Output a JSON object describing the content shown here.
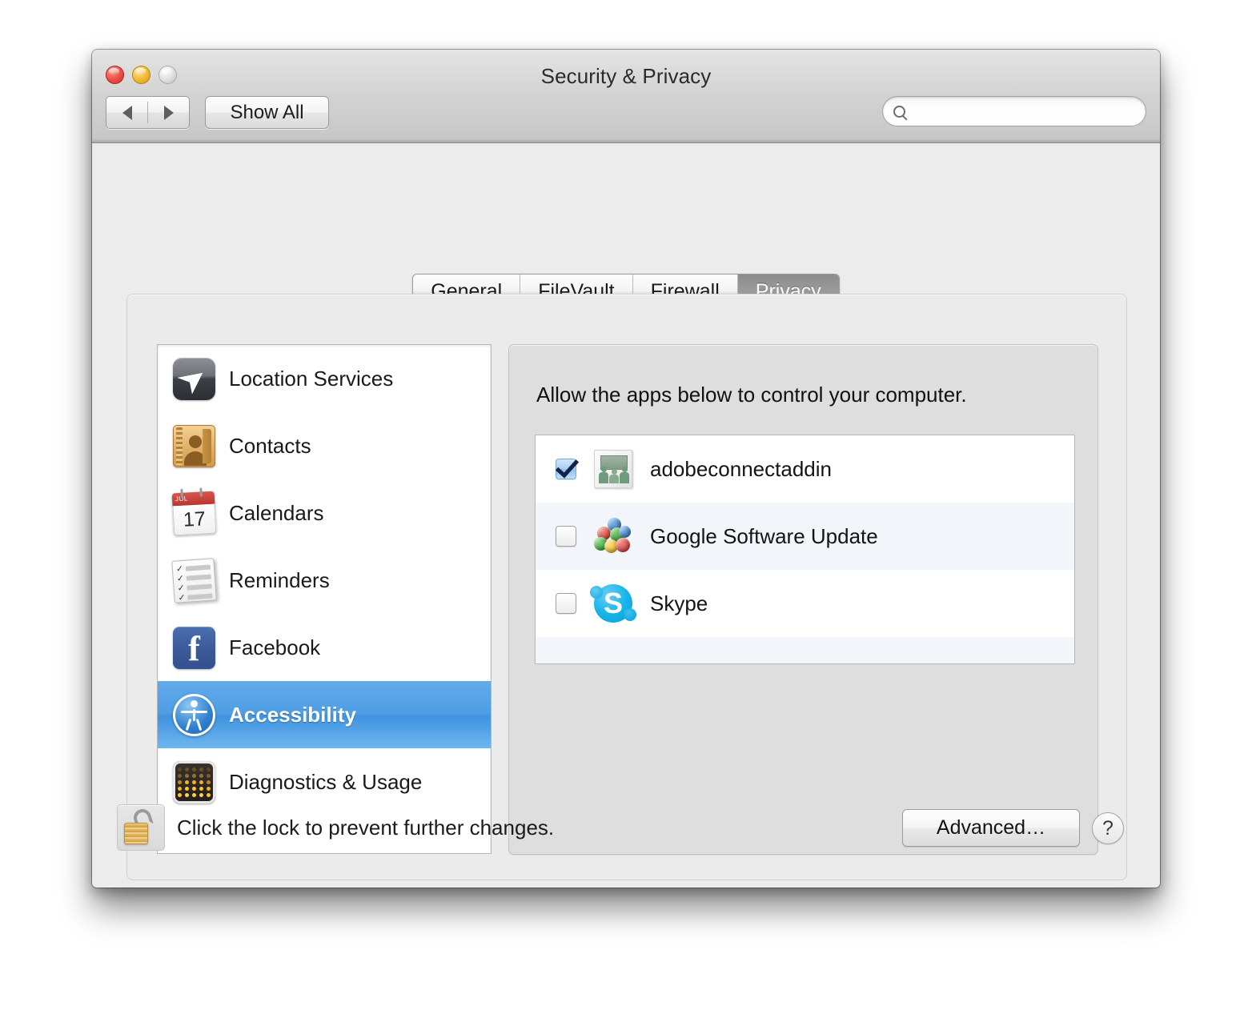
{
  "window": {
    "title": "Security & Privacy",
    "traffic_lights": [
      {
        "name": "close",
        "color": "#f0544a"
      },
      {
        "name": "minimize",
        "color": "#f4bd3f"
      },
      {
        "name": "zoom",
        "color": "#e2e2e2"
      }
    ]
  },
  "toolbar": {
    "back_icon": "back-arrow-icon",
    "forward_icon": "forward-arrow-icon",
    "show_all_label": "Show All",
    "search": {
      "icon": "search-icon",
      "value": "",
      "placeholder": ""
    }
  },
  "tabs": [
    {
      "label": "General",
      "active": false
    },
    {
      "label": "FileVault",
      "active": false
    },
    {
      "label": "Firewall",
      "active": false
    },
    {
      "label": "Privacy",
      "active": true
    }
  ],
  "sidebar": {
    "items": [
      {
        "label": "Location Services",
        "icon": "location-arrow-icon",
        "selected": false
      },
      {
        "label": "Contacts",
        "icon": "address-book-icon",
        "selected": false
      },
      {
        "label": "Calendars",
        "icon": "calendar-icon",
        "selected": false
      },
      {
        "label": "Reminders",
        "icon": "reminders-list-icon",
        "selected": false
      },
      {
        "label": "Facebook",
        "icon": "facebook-icon",
        "selected": false
      },
      {
        "label": "Accessibility",
        "icon": "accessibility-icon",
        "selected": true
      },
      {
        "label": "Diagnostics & Usage",
        "icon": "diagnostics-dots-icon",
        "selected": false
      }
    ],
    "calendar_icon": {
      "month": "JUL",
      "day": "17"
    },
    "facebook_icon_glyph": "f",
    "reminders_check_glyph": "✓"
  },
  "panel": {
    "heading": "Allow the apps below to control your computer.",
    "apps": [
      {
        "name": "adobeconnectaddin",
        "checked": true,
        "icon": "adobe-connect-addin-icon"
      },
      {
        "name": "Google Software Update",
        "checked": false,
        "icon": "google-software-update-icon"
      },
      {
        "name": "Skype",
        "checked": false,
        "icon": "skype-icon"
      }
    ],
    "skype_glyph": "S",
    "empty_rows": 2
  },
  "footer": {
    "lock_icon": "unlocked-padlock-icon",
    "lock_text": "Click the lock to prevent further changes.",
    "advanced_label": "Advanced…",
    "help_label": "?"
  },
  "colors": {
    "selection_blue": "#4e9ee4",
    "active_tab_gray": "#9b9b9b",
    "row_stripe": "#f2f5fa",
    "window_chrome": "#ececec"
  }
}
